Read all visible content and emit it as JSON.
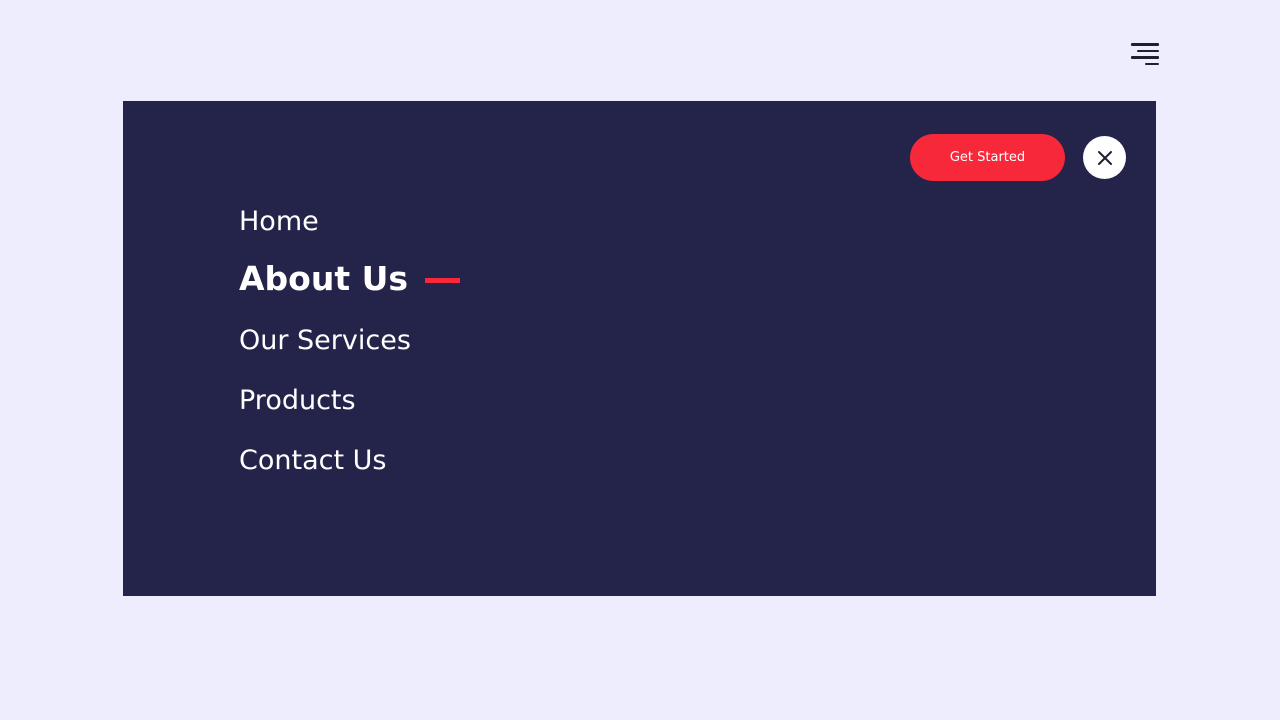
{
  "menu": {
    "cta_label": "Get Started",
    "items": [
      {
        "label": "Home"
      },
      {
        "label": "About Us"
      },
      {
        "label": "Our Services"
      },
      {
        "label": "Products"
      },
      {
        "label": "Contact Us"
      }
    ]
  },
  "icons": {
    "open": "hamburger-menu-icon",
    "close": "close-icon"
  },
  "colors": {
    "page_background": "#eeedfd",
    "panel_background": "#24234a",
    "accent": "#f7283a",
    "text": "#ffffff"
  }
}
